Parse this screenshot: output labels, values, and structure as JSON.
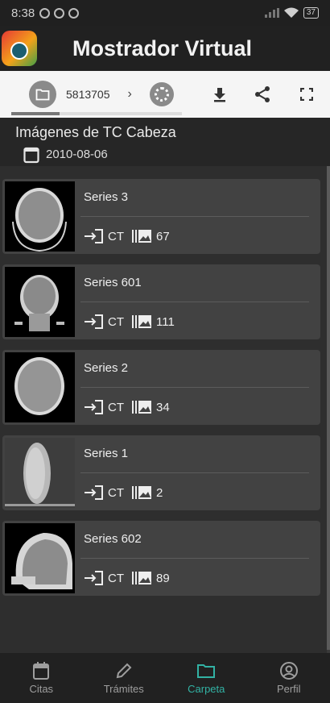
{
  "status_bar": {
    "time": "8:38",
    "battery": "37"
  },
  "app": {
    "title": "Mostrador Virtual"
  },
  "toolbar": {
    "breadcrumb_id": "5813705",
    "chevron": "›"
  },
  "study": {
    "title": "Imágenes de TC Cabeza",
    "date": "2010-08-06"
  },
  "series": [
    {
      "name": "Series 3",
      "modality": "CT",
      "count": "67"
    },
    {
      "name": "Series 601",
      "modality": "CT",
      "count": "111"
    },
    {
      "name": "Series 2",
      "modality": "CT",
      "count": "34"
    },
    {
      "name": "Series 1",
      "modality": "CT",
      "count": "2"
    },
    {
      "name": "Series 602",
      "modality": "CT",
      "count": "89"
    }
  ],
  "bottom_nav": [
    {
      "label": "Citas",
      "icon": "calendar-icon"
    },
    {
      "label": "Trámites",
      "icon": "pencil-icon"
    },
    {
      "label": "Carpeta",
      "icon": "folder-icon",
      "active": true
    },
    {
      "label": "Perfil",
      "icon": "account-icon"
    }
  ],
  "colors": {
    "accent": "#32b2a4",
    "background": "#2e2e2e",
    "card": "#424242"
  }
}
